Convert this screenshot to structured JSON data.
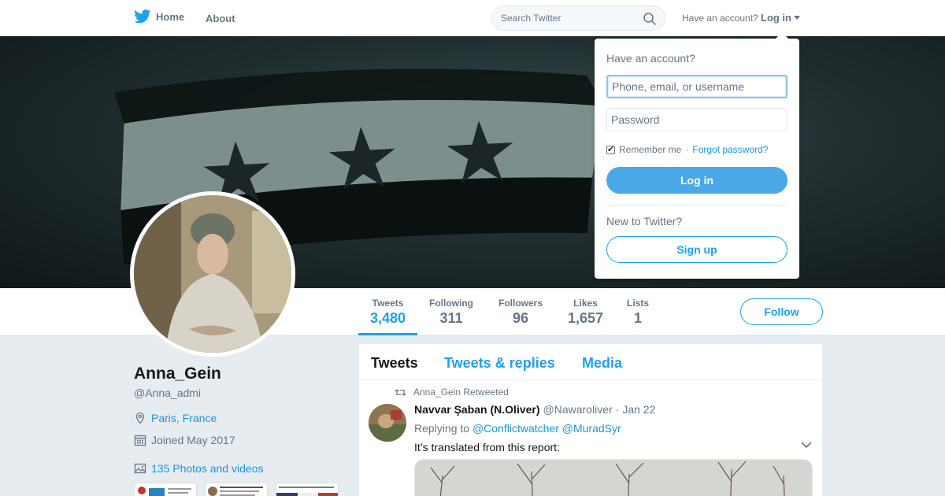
{
  "topbar": {
    "home_label": "Home",
    "about_label": "About",
    "search_placeholder": "Search Twitter",
    "have_account": "Have an account?",
    "login_label": "Log in"
  },
  "profile": {
    "name": "Anna_Gein",
    "handle": "@Anna_admi",
    "location": "Paris, France",
    "joined": "Joined May 2017",
    "photos_link": "135 Photos and videos"
  },
  "stats": [
    {
      "label": "Tweets",
      "value": "3,480"
    },
    {
      "label": "Following",
      "value": "311"
    },
    {
      "label": "Followers",
      "value": "96"
    },
    {
      "label": "Likes",
      "value": "1,657"
    },
    {
      "label": "Lists",
      "value": "1"
    }
  ],
  "follow_label": "Follow",
  "timeline": {
    "tabs": [
      "Tweets",
      "Tweets & replies",
      "Media"
    ],
    "tweet": {
      "retweet_label": "Anna_Gein Retweeted",
      "author_name": "Navvar Şaban (N.Oliver)",
      "author_handle": "@Nawaroliver",
      "separator": "·",
      "date": "Jan 22",
      "replying_prefix": "Replying to",
      "reply_to_1": "@Conflictwatcher",
      "reply_to_2": "@MuradSyr",
      "text": "It’s translated from this report:"
    }
  },
  "login_dropdown": {
    "title": "Have an account?",
    "username_placeholder": "Phone, email, or username",
    "password_placeholder": "Password",
    "remember_label": "Remember me",
    "separator": "·",
    "forgot_label": "Forgot password?",
    "login_button": "Log in",
    "new_label": "New to Twitter?",
    "signup_button": "Sign up"
  },
  "colors": {
    "accent": "#1da1f2",
    "link": "#1b95e0",
    "login_button_bg": "#4aa8e8",
    "page_bg": "#e6ecf0"
  }
}
